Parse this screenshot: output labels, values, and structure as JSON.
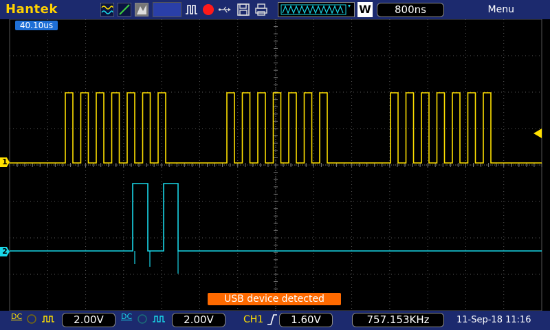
{
  "header": {
    "brand": "Hantek",
    "timebase": "800ns",
    "trigger_mode_letter": "W",
    "menu_label": "Menu"
  },
  "plot": {
    "time_position": "40.10us",
    "ch1_marker": "1",
    "ch2_marker": "2",
    "status_message": "USB device detected"
  },
  "footer": {
    "ch1_scale": "2.00V",
    "ch2_scale": "2.00V",
    "trigger_source": "CH1",
    "trigger_level": "1.60V",
    "frequency": "757.153KHz",
    "datetime": "11-Sep-18 11:16",
    "coupling_label": "DC"
  },
  "colors": {
    "ch1": "#ffe000",
    "ch2": "#19d7e8",
    "grid": "#5a5a5a",
    "bar": "#1c2a6e"
  },
  "icons": [
    "wave-icon",
    "ramp-icon",
    "shade-icon",
    "run-icon",
    "record-icon",
    "save-icon",
    "print-icon",
    "trigger-edge-icon"
  ]
}
